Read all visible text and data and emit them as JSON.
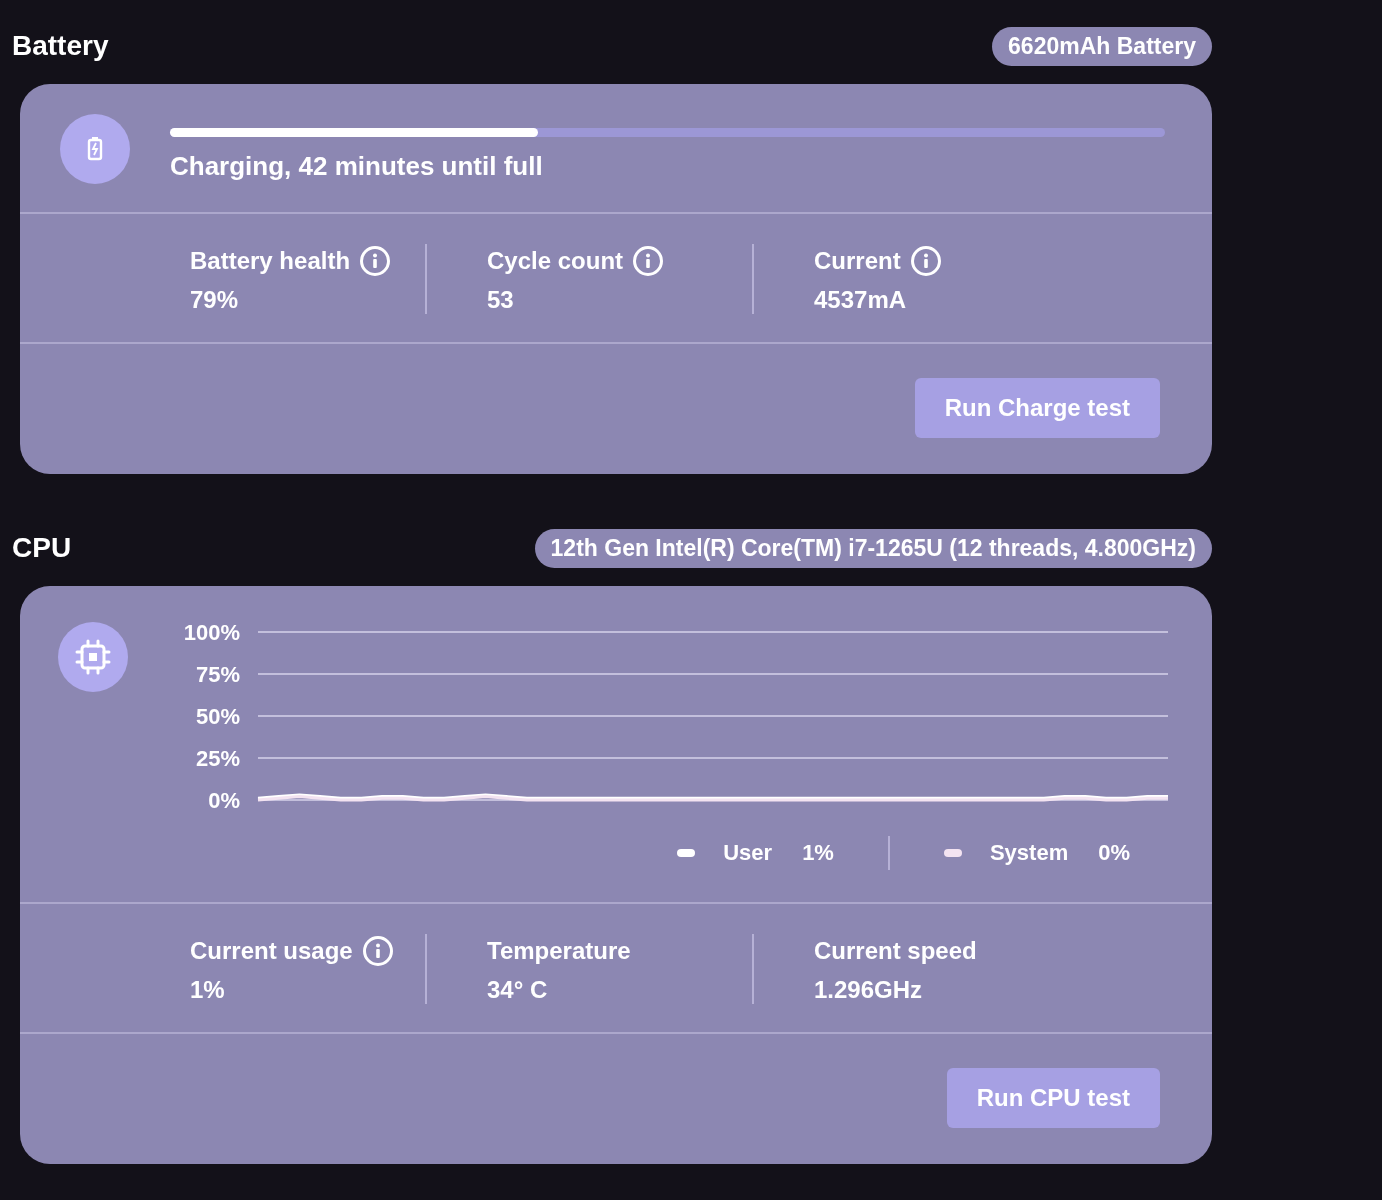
{
  "battery": {
    "title": "Battery",
    "chip": "6620mAh Battery",
    "charge": {
      "level": 0.37,
      "status": "Charging, 42 minutes until full"
    },
    "stats": [
      {
        "label": "Battery health",
        "value": "79%",
        "info": true
      },
      {
        "label": "Cycle count",
        "value": "53",
        "info": true
      },
      {
        "label": "Current",
        "value": "4537mA",
        "info": true
      }
    ],
    "button": "Run Charge test"
  },
  "cpu": {
    "title": "CPU",
    "chip": "12th Gen Intel(R) Core(TM) i7-1265U (12 threads, 4.800GHz)",
    "chart_data": {
      "type": "line",
      "grid": true,
      "ylim": [
        0,
        100
      ],
      "yticks": [
        {
          "value": 0,
          "label": "0%"
        },
        {
          "value": 25,
          "label": "25%"
        },
        {
          "value": 50,
          "label": "50%"
        },
        {
          "value": 75,
          "label": "75%"
        },
        {
          "value": 100,
          "label": "100%"
        }
      ],
      "series": [
        {
          "name": "User",
          "color": "#ffffff",
          "values": [
            1,
            2,
            3,
            2,
            1,
            1,
            2,
            2,
            1,
            1,
            2,
            3,
            2,
            1,
            1,
            1,
            1,
            1,
            1,
            1,
            1,
            1,
            1,
            1,
            1,
            1,
            1,
            1,
            1,
            1,
            1,
            1,
            1,
            1,
            1,
            1,
            1,
            1,
            1,
            2,
            2,
            1,
            1,
            2,
            2
          ]
        },
        {
          "name": "System",
          "color": "#f3e3f1",
          "values": [
            0,
            1,
            2,
            1,
            0,
            0,
            1,
            1,
            0,
            0,
            1,
            2,
            1,
            0,
            0,
            0,
            0,
            0,
            0,
            0,
            0,
            0,
            0,
            0,
            0,
            0,
            0,
            0,
            0,
            0,
            0,
            0,
            0,
            0,
            0,
            0,
            0,
            0,
            0,
            1,
            1,
            0,
            0,
            1,
            1
          ]
        }
      ]
    },
    "legend": [
      {
        "reading": "1%"
      },
      {
        "reading": "0%"
      }
    ],
    "stats": [
      {
        "label": "Current usage",
        "value": "1%",
        "info": true
      },
      {
        "label": "Temperature",
        "value": "34° C",
        "info": false
      },
      {
        "label": "Current speed",
        "value": "1.296GHz",
        "info": false
      }
    ],
    "button": "Run CPU test"
  }
}
